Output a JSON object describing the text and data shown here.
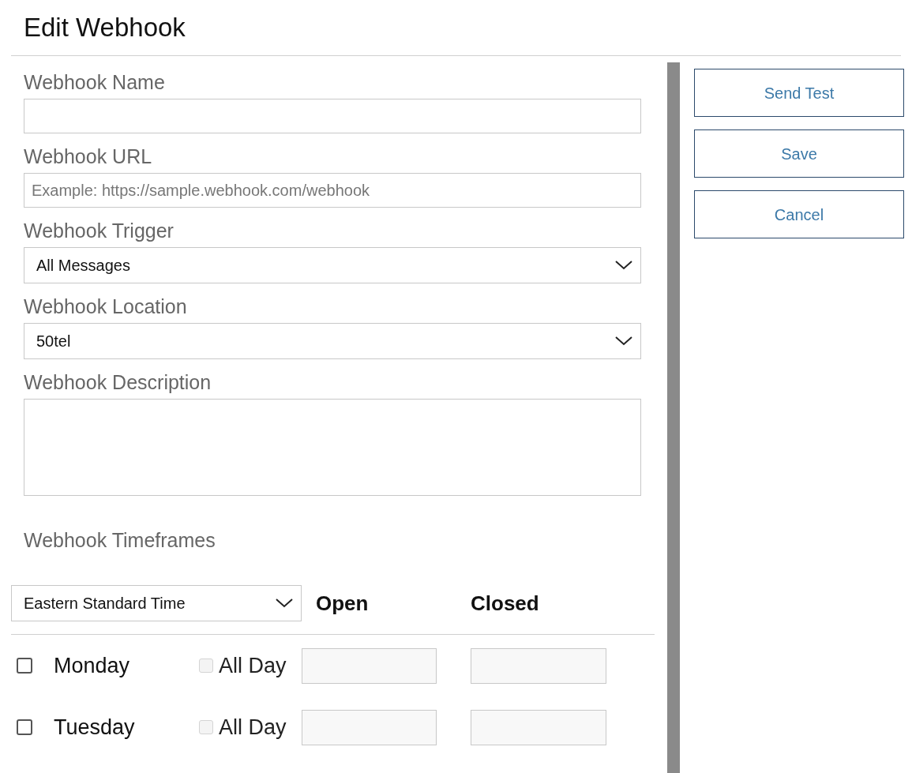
{
  "title": "Edit Webhook",
  "fields": [
    {
      "kind": "text",
      "label": "Webhook Name"
    },
    {
      "kind": "text",
      "label": "Webhook URL",
      "placeholder": "Example: https://sample.webhook.com/webhook"
    },
    {
      "kind": "select",
      "label": "Webhook Trigger",
      "value": "All Messages"
    },
    {
      "kind": "select",
      "label": "Webhook Location",
      "value": "50tel"
    },
    {
      "kind": "textarea",
      "label": "Webhook Description"
    }
  ],
  "timeframes": {
    "label": "Webhook Timeframes",
    "timezone": "Eastern Standard Time",
    "columns": [
      "Open",
      "Closed"
    ],
    "days": [
      {
        "name": "Monday",
        "checked": false,
        "all_day_label": "All Day",
        "all_day": false,
        "all_day_disabled": true
      },
      {
        "name": "Tuesday",
        "checked": false,
        "all_day_label": "All Day",
        "all_day": false,
        "all_day_disabled": true
      }
    ]
  },
  "buttons": [
    "Send Test",
    "Save",
    "Cancel"
  ]
}
